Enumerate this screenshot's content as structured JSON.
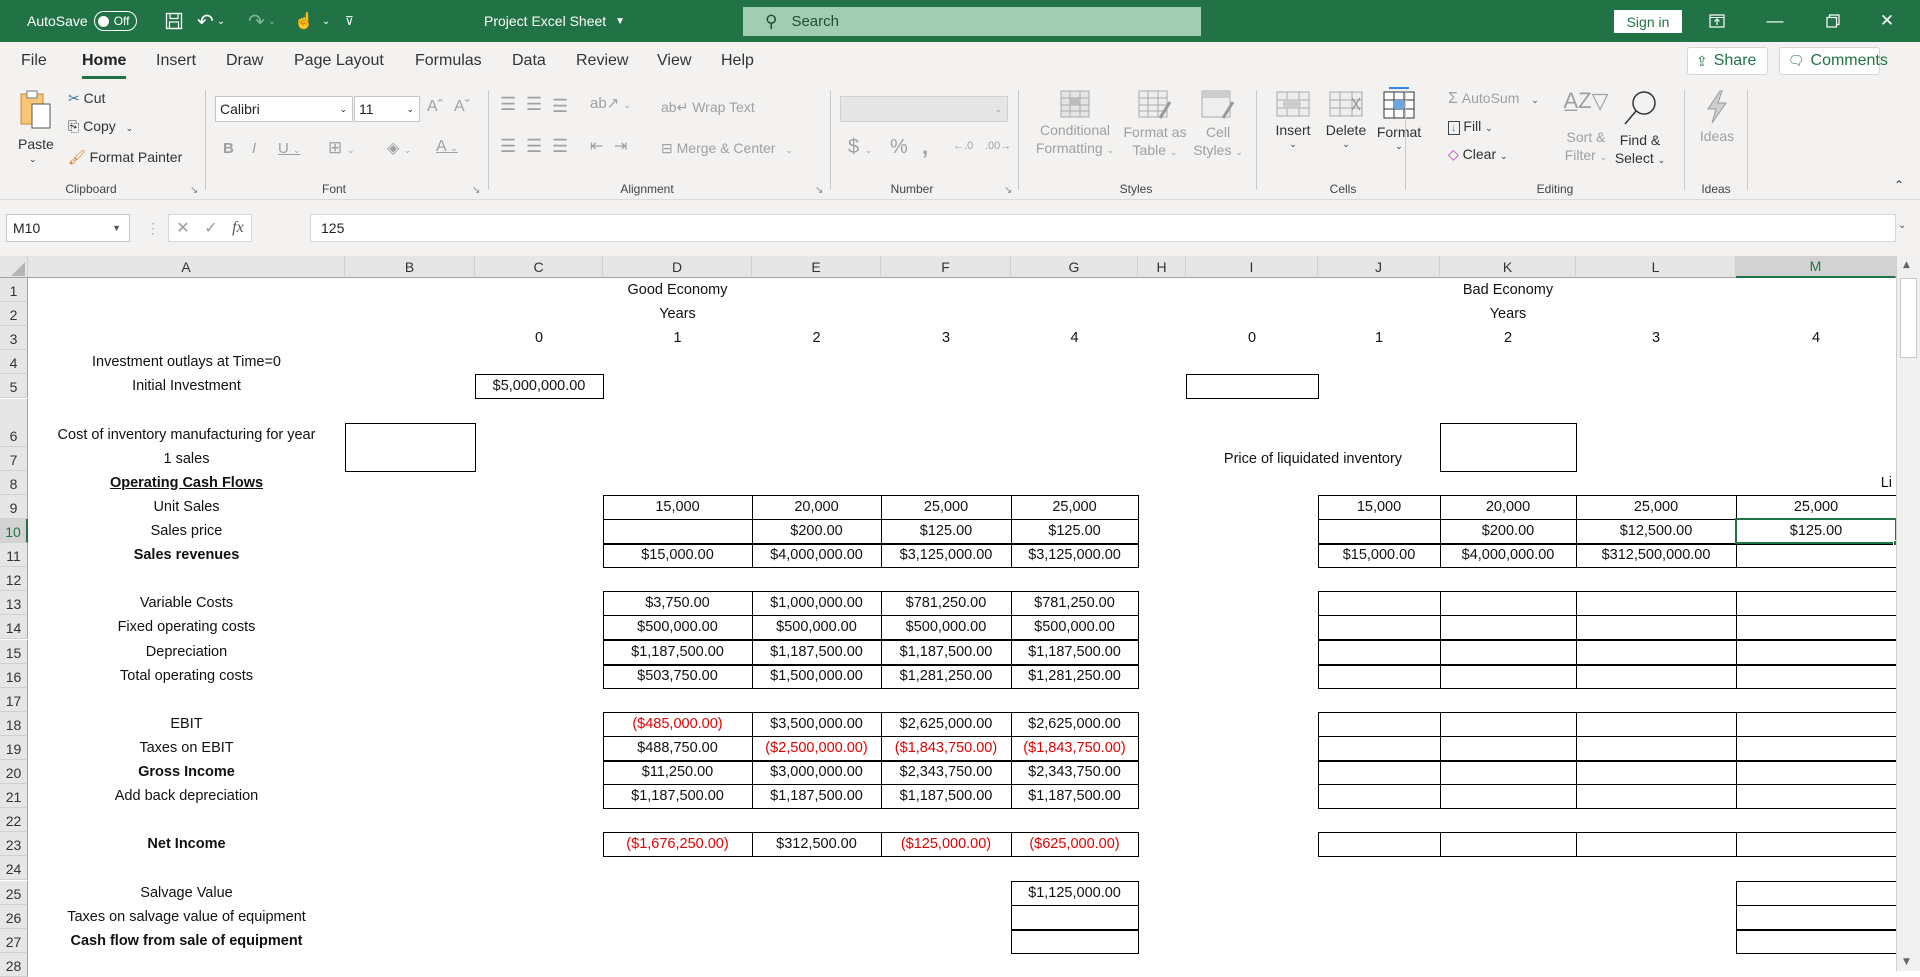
{
  "titlebar": {
    "autosave_label": "AutoSave",
    "autosave_state": "Off",
    "doc_title": "Project Excel Sheet",
    "search_placeholder": "Search",
    "signin": "Sign in"
  },
  "tabs": [
    "File",
    "Home",
    "Insert",
    "Draw",
    "Page Layout",
    "Formulas",
    "Data",
    "Review",
    "View",
    "Help"
  ],
  "active_tab": "Home",
  "share_label": "Share",
  "comments_label": "Comments",
  "ribbon": {
    "clipboard": {
      "paste": "Paste",
      "cut": "Cut",
      "copy": "Copy",
      "format_painter": "Format Painter",
      "label": "Clipboard"
    },
    "font": {
      "name": "Calibri",
      "size": "11",
      "label": "Font"
    },
    "alignment": {
      "wrap_text": "Wrap Text",
      "merge_center": "Merge & Center",
      "label": "Alignment"
    },
    "number": {
      "format": "",
      "label": "Number"
    },
    "styles": {
      "conditional": "Conditional",
      "formatting": "Formatting",
      "format_as": "Format as",
      "table": "Table",
      "cell": "Cell",
      "styles_btn": "Styles",
      "label": "Styles"
    },
    "cells": {
      "insert": "Insert",
      "delete": "Delete",
      "format": "Format",
      "label": "Cells"
    },
    "editing": {
      "autosum": "AutoSum",
      "fill": "Fill",
      "clear": "Clear",
      "sort1": "Sort &",
      "sort2": "Filter",
      "find1": "Find &",
      "find2": "Select",
      "label": "Editing"
    },
    "ideas": {
      "btn": "Ideas",
      "label": "Ideas"
    }
  },
  "formula_bar": {
    "name_box": "M10",
    "fx": "fx",
    "value": "125"
  },
  "columns": [
    "A",
    "B",
    "C",
    "D",
    "E",
    "F",
    "G",
    "H",
    "I",
    "J",
    "K",
    "L",
    "M"
  ],
  "selected_column": "M",
  "rows": [
    "1",
    "2",
    "3",
    "4",
    "5",
    "6",
    "7",
    "8",
    "9",
    "10",
    "11",
    "12",
    "13",
    "14",
    "15",
    "16",
    "17",
    "18",
    "19",
    "20",
    "21",
    "22",
    "23",
    "24",
    "25",
    "26",
    "27",
    "28"
  ],
  "selected_row": "10",
  "sheet": {
    "good_title": "Good Economy",
    "good_years": "Years",
    "bad_title": "Bad Economy",
    "bad_years": "Years",
    "good_year_headers": [
      "0",
      "1",
      "2",
      "3",
      "4"
    ],
    "bad_year_headers": [
      "0",
      "1",
      "2",
      "3",
      "4"
    ],
    "labels": {
      "investment_outlays": "Investment outlays at Time=0",
      "initial_investment": "Initial Investment",
      "inventory_cost_1": "Cost of inventory manufacturing for year",
      "inventory_cost_2": "1 sales",
      "operating_cf": "Operating Cash Flows",
      "unit_sales": "Unit Sales",
      "sales_price": "Sales price",
      "sales_revenues": "Sales revenues",
      "variable_costs": "Variable Costs",
      "fixed_costs": "Fixed operating costs",
      "depreciation": "Depreciation",
      "total_costs": "Total operating costs",
      "ebit": "EBIT",
      "taxes_ebit": "Taxes on EBIT",
      "gross_income": "Gross Income",
      "add_back_dep": "Add back depreciation",
      "net_income": "Net Income",
      "salvage_value": "Salvage Value",
      "taxes_salvage": "Taxes on salvage value of equipment",
      "cf_sale_equipment": "Cash flow from sale of equipment",
      "price_liquidated": "Price of liquidated inventory",
      "liq_cutoff": "Li"
    },
    "initial_investment_good": "$5,000,000.00",
    "good": {
      "unit_sales": [
        "15,000",
        "20,000",
        "25,000",
        "25,000"
      ],
      "sales_price": [
        "",
        "$200.00",
        "$125.00",
        "$125.00"
      ],
      "sales_revenues": [
        "$15,000.00",
        "$4,000,000.00",
        "$3,125,000.00",
        "$3,125,000.00"
      ],
      "variable_costs": [
        "$3,750.00",
        "$1,000,000.00",
        "$781,250.00",
        "$781,250.00"
      ],
      "fixed_costs": [
        "$500,000.00",
        "$500,000.00",
        "$500,000.00",
        "$500,000.00"
      ],
      "depreciation": [
        "$1,187,500.00",
        "$1,187,500.00",
        "$1,187,500.00",
        "$1,187,500.00"
      ],
      "total_costs": [
        "$503,750.00",
        "$1,500,000.00",
        "$1,281,250.00",
        "$1,281,250.00"
      ],
      "ebit": [
        "($485,000.00)",
        "$3,500,000.00",
        "$2,625,000.00",
        "$2,625,000.00"
      ],
      "taxes_ebit": [
        "$488,750.00",
        "($2,500,000.00)",
        "($1,843,750.00)",
        "($1,843,750.00)"
      ],
      "gross_income": [
        "$11,250.00",
        "$3,000,000.00",
        "$2,343,750.00",
        "$2,343,750.00"
      ],
      "add_back_dep": [
        "$1,187,500.00",
        "$1,187,500.00",
        "$1,187,500.00",
        "$1,187,500.00"
      ],
      "net_income": [
        "($1,676,250.00)",
        "$312,500.00",
        "($125,000.00)",
        "($625,000.00)"
      ],
      "salvage_value": "$1,125,000.00"
    },
    "bad": {
      "unit_sales": [
        "15,000",
        "20,000",
        "25,000",
        "25,000"
      ],
      "sales_price": [
        "",
        "$200.00",
        "$12,500.00",
        "$125.00"
      ],
      "sales_revenues": [
        "$15,000.00",
        "$4,000,000.00",
        "$312,500,000.00",
        ""
      ]
    },
    "negative_color": "#e00000"
  }
}
